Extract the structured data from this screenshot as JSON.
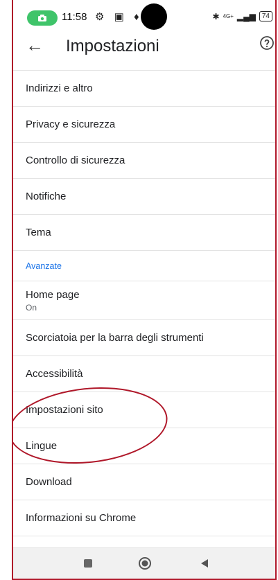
{
  "status_bar": {
    "time": "11:58",
    "notif_icons": "⚙ ▣ ♦ ■",
    "network": "4G+",
    "battery": "74"
  },
  "header": {
    "title": "Impostazioni"
  },
  "settings": {
    "items": [
      {
        "label": "Indirizzi e altro"
      },
      {
        "label": "Privacy e sicurezza"
      },
      {
        "label": "Controllo di sicurezza"
      },
      {
        "label": "Notifiche"
      },
      {
        "label": "Tema"
      }
    ],
    "advanced_header": "Avanzate",
    "advanced_items": [
      {
        "label": "Home page",
        "sub": "On"
      },
      {
        "label": "Scorciatoia per la barra degli strumenti"
      },
      {
        "label": "Accessibilità"
      },
      {
        "label": "Impostazioni sito"
      },
      {
        "label": "Lingue"
      },
      {
        "label": "Download"
      },
      {
        "label": "Informazioni su Chrome"
      }
    ]
  },
  "colors": {
    "accent": "#1a73e8",
    "annotation": "#b0182a",
    "status_pill": "#3fc46a"
  }
}
